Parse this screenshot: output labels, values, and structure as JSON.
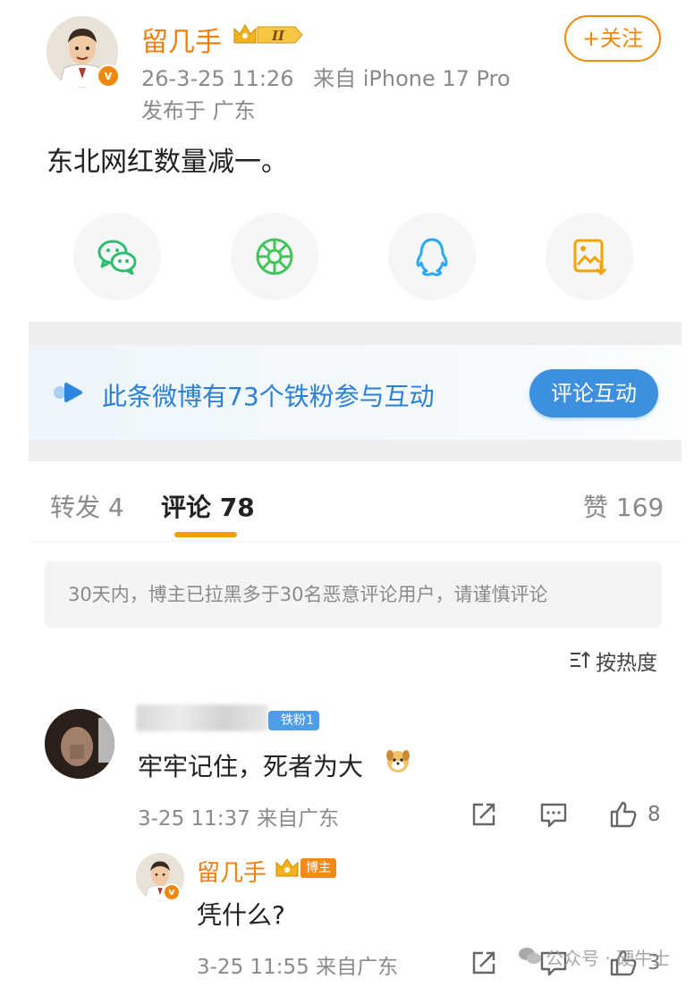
{
  "post": {
    "author": "留几手",
    "verified_mark": "v",
    "crown_level": "II",
    "timestamp": "26-3-25 11:26",
    "source": "来自 iPhone 17 Pro",
    "location": "发布于 广东",
    "follow_label": "+关注",
    "text": "东北网红数量减一。",
    "share_icons": [
      "wechat-icon",
      "moments-icon",
      "qq-icon",
      "save-image-icon"
    ]
  },
  "fan_banner": {
    "text": "此条微博有73个铁粉参与互动",
    "button": "评论互动"
  },
  "tabs": {
    "repost": "转发 4",
    "comments": "评论 78",
    "likes": "赞 169"
  },
  "notice": "30天内，博主已拉黑多于30名恶意评论用户，请谨慎评论",
  "sort": {
    "label": "按热度",
    "icon": "sort-icon"
  },
  "comment": {
    "fan_tag": "铁粉1",
    "text": "牢牢记住，死者为大",
    "emoji": "dog-emoji",
    "time": "3-25 11:37 来自广东",
    "likes": "8"
  },
  "reply": {
    "author": "留几手",
    "tag": "博主",
    "text": "凭什么?",
    "time": "3-25 11:55 来自广东",
    "likes": "3"
  },
  "watermark": "公众号 · 硬牛士",
  "colors": {
    "brand_orange": "#f07f10",
    "link_blue": "#2a7fd8",
    "button_blue": "#3d8fe0",
    "tab_underline": "#f0a000"
  }
}
